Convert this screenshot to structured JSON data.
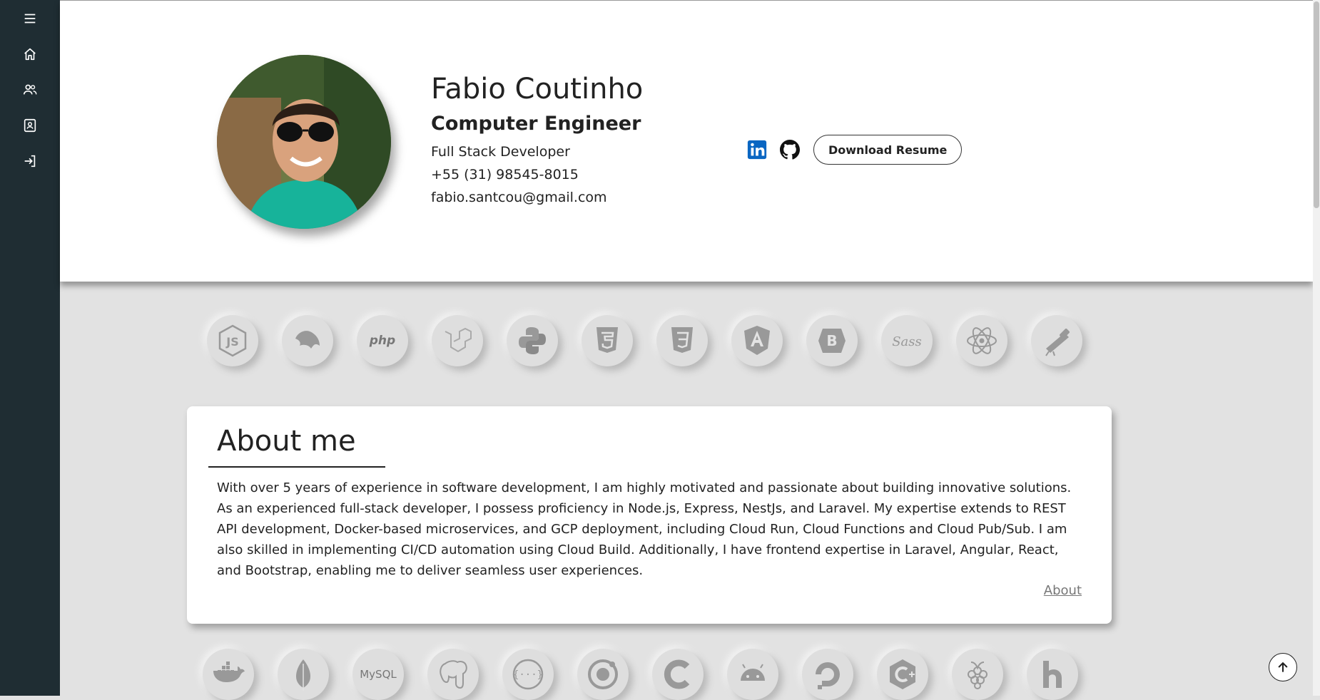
{
  "sidebar": {
    "items": [
      {
        "icon": "menu-icon"
      },
      {
        "icon": "home-icon"
      },
      {
        "icon": "people-icon"
      },
      {
        "icon": "contact-card-icon"
      },
      {
        "icon": "login-icon"
      }
    ],
    "color": "#1f2d33"
  },
  "profile": {
    "name": "Fabio Coutinho",
    "title": "Computer Engineer",
    "subtitle": "Full Stack Developer",
    "phone": "+55 (31) 98545-8015",
    "email": "fabio.santcou@gmail.com"
  },
  "social": {
    "linkedin_icon": "linkedin-icon",
    "github_icon": "github-icon",
    "resume_label": "Download Resume",
    "linkedin_color": "#0a66c2"
  },
  "tech_row_1": [
    "js-icon",
    "nestjs-icon",
    "php-icon",
    "laravel-icon",
    "python-icon",
    "html5-icon",
    "css3-icon",
    "angular-icon",
    "bootstrap-icon",
    "sass-icon",
    "react-icon",
    "telescope-icon"
  ],
  "tech_row_2": [
    "docker-icon",
    "mongodb-icon",
    "mysql-icon",
    "postgresql-icon",
    "json-icon",
    "ionic-icon",
    "c-icon",
    "android-icon",
    "digitalocean-icon",
    "cplusplus-icon",
    "raspberrypi-icon",
    "heroku-icon"
  ],
  "tech_labels": {
    "php": "php",
    "mysql": "MySQL"
  },
  "about": {
    "heading": "About me",
    "text": "With over 5 years of experience in software development, I am highly motivated and passionate about building innovative solutions. As an experienced full-stack developer, I possess proficiency in Node.js, Express, NestJs, and Laravel. My expertise extends to REST API development, Docker-based microservices, and GCP deployment, including Cloud Run, Cloud Functions and Cloud Pub/Sub. I am also skilled in implementing CI/CD automation using Cloud Build. Additionally, I have frontend expertise in Laravel, Angular, React, and Bootstrap, enabling me to deliver seamless user experiences.",
    "link_label": "About"
  }
}
